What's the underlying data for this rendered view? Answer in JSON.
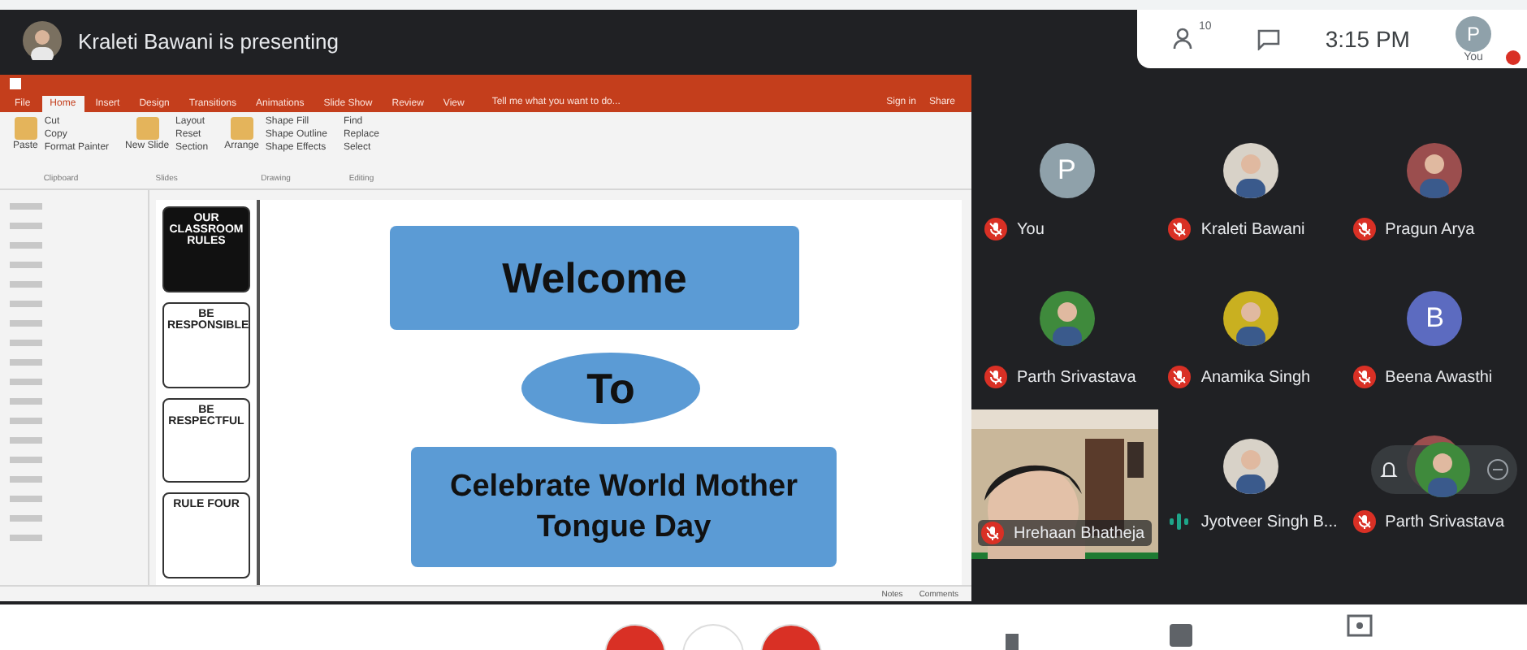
{
  "presenter_bar": {
    "text": "Kraleti Bawani is presenting"
  },
  "top_panel": {
    "people_count": "10",
    "time": "3:15 PM",
    "self_label": "You",
    "self_initial": "P"
  },
  "powerpoint": {
    "tabs": [
      {
        "label": "File",
        "selected": false
      },
      {
        "label": "Home",
        "selected": true
      },
      {
        "label": "Insert",
        "selected": false
      },
      {
        "label": "Design",
        "selected": false
      },
      {
        "label": "Transitions",
        "selected": false
      },
      {
        "label": "Animations",
        "selected": false
      },
      {
        "label": "Slide Show",
        "selected": false
      },
      {
        "label": "Review",
        "selected": false
      },
      {
        "label": "View",
        "selected": false
      }
    ],
    "tell_me": "Tell me what you want to do...",
    "sign_in": "Sign in",
    "share": "Share",
    "ribbon_groups": [
      {
        "name": "Clipboard",
        "items": [
          "Cut",
          "Copy",
          "Format Painter"
        ],
        "big": "Paste"
      },
      {
        "name": "Slides",
        "items": [
          "Layout",
          "Reset",
          "Section"
        ],
        "big": "New Slide"
      },
      {
        "name": "Drawing",
        "items": [
          "Shape Fill",
          "Shape Outline",
          "Shape Effects"
        ],
        "big": "Arrange"
      },
      {
        "name": "Editing",
        "items": [
          "Find",
          "Replace",
          "Select"
        ]
      }
    ],
    "rule_cards": [
      {
        "text": "OUR CLASSROOM RULES",
        "kind": "title"
      },
      {
        "text": "BE RESPONSIBLE",
        "kind": "rule"
      },
      {
        "text": "BE RESPECTFUL",
        "kind": "rule"
      },
      {
        "text": "RULE FOUR",
        "kind": "rule"
      }
    ],
    "slide": {
      "line_1": "Welcome",
      "line_2": "To",
      "line_3": "Celebrate World Mother Tongue Day"
    },
    "status": {
      "notes": "Notes",
      "comments": "Comments"
    }
  },
  "participants": [
    {
      "name": "You",
      "avatar": {
        "kind": "initial",
        "initial": "P",
        "color": "#8fa1aa"
      },
      "muted": true
    },
    {
      "name": "Kraleti Bawani",
      "muted": true
    },
    {
      "name": "Pragun Arya",
      "muted": true
    },
    {
      "name": "Parth Srivastava",
      "muted": true
    },
    {
      "name": "Anamika Singh",
      "muted": true
    },
    {
      "name": "Beena Awasthi",
      "avatar": {
        "kind": "initial",
        "initial": "B",
        "color": "#5c6bc0"
      },
      "muted": true
    },
    {
      "name": "Hrehaan Bhatheja",
      "kind": "video",
      "muted": true
    },
    {
      "name": "Jyotveer Singh B...",
      "muted": false
    },
    {
      "name": "Parth Srivastava",
      "muted": true,
      "hover_controls": true
    }
  ]
}
